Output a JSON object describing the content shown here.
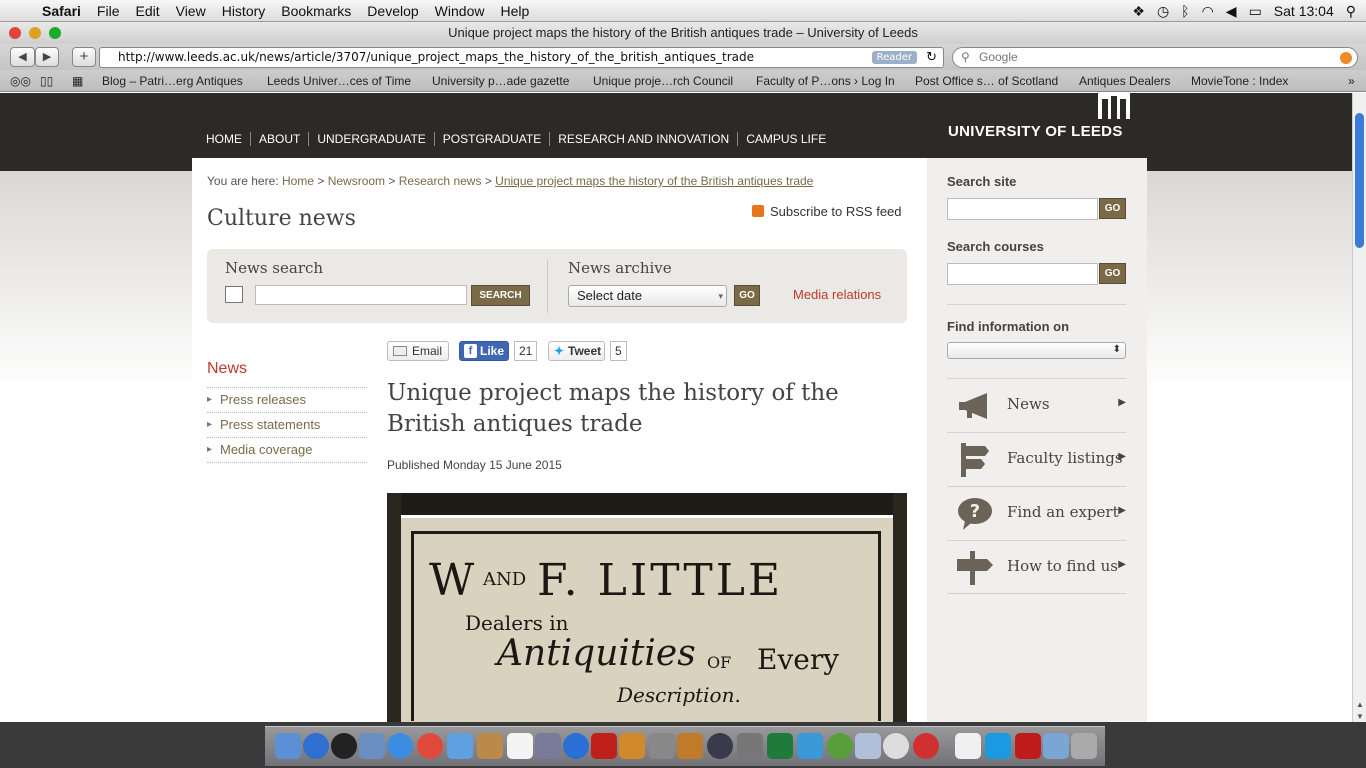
{
  "menubar": {
    "app": "Safari",
    "items": [
      "File",
      "Edit",
      "View",
      "History",
      "Bookmarks",
      "Develop",
      "Window",
      "Help"
    ],
    "clock": "Sat 13:04"
  },
  "window": {
    "title": "Unique project maps the history of the British antiques trade – University of Leeds"
  },
  "toolbar": {
    "url": "http://www.leeds.ac.uk/news/article/3707/unique_project_maps_the_history_of_the_british_antiques_trade",
    "reader_label": "Reader",
    "search_placeholder": "Google"
  },
  "bookmarks": [
    "Blog – Patri…erg Antiques",
    "Leeds Univer…ces of Time",
    "University p…ade gazette",
    "Unique proje…rch Council",
    "Faculty of P…ons › Log In",
    "Post Office s… of Scotland",
    "Antiques Dealers",
    "MovieTone : Index"
  ],
  "site": {
    "logo_text": "UNIVERSITY OF LEEDS",
    "nav": [
      "HOME",
      "ABOUT",
      "UNDERGRADUATE",
      "POSTGRADUATE",
      "RESEARCH AND INNOVATION",
      "CAMPUS LIFE"
    ]
  },
  "breadcrumb": {
    "prefix": "You are here:",
    "items": [
      "Home",
      "Newsroom",
      "Research news"
    ],
    "current": "Unique project maps the history of the British antiques trade",
    "sep": ">"
  },
  "page": {
    "section_title": "Culture news",
    "rss_label": "Subscribe to RSS feed"
  },
  "search_panel": {
    "news_search_title": "News search",
    "search_button": "SEARCH",
    "archive_title": "News archive",
    "archive_select": "Select date",
    "go": "GO",
    "media_relations": "Media relations"
  },
  "left_nav": {
    "heading": "News",
    "items": [
      "Press releases",
      "Press statements",
      "Media coverage"
    ]
  },
  "share": {
    "email": "Email",
    "like": "Like",
    "like_count": "21",
    "tweet": "Tweet",
    "tweet_count": "5"
  },
  "article": {
    "title": "Unique project maps the history of the British antiques trade",
    "published": "Published Monday 15 June 2015",
    "image_sign_line1": "W",
    "image_sign_and": "AND",
    "image_sign_line1b": "F. LITTLE",
    "image_sign_line2": "Dealers in",
    "image_sign_line3": "Antiquities",
    "image_sign_of": "OF",
    "image_sign_every": "Every",
    "image_sign_line4": "Description."
  },
  "right_col": {
    "search_site": "Search site",
    "search_courses": "Search courses",
    "find_info": "Find information on",
    "go": "GO",
    "links": [
      "News",
      "Faculty listings",
      "Find an expert",
      "How to find us"
    ]
  },
  "colors": {
    "header_bg": "#2c2a27",
    "accent_brown": "#7a6a48",
    "red_link": "#c0392b",
    "scroll_thumb": "#3c7ad9"
  }
}
